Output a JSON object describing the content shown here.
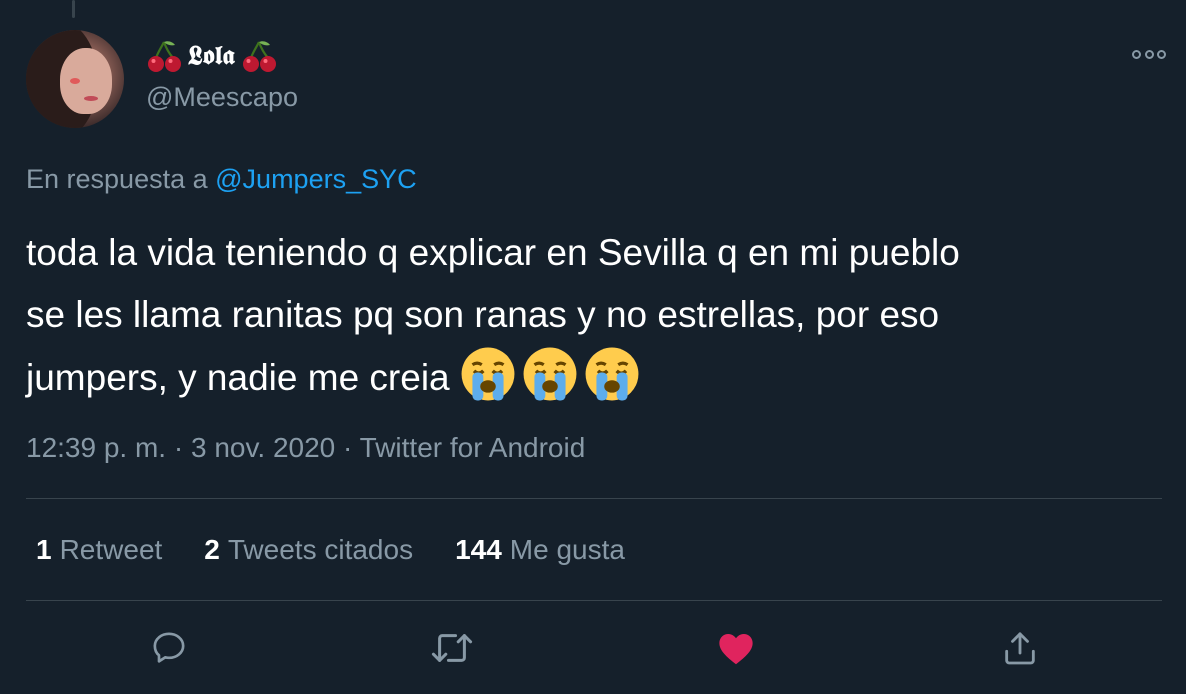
{
  "author": {
    "display_name": "𝕷𝖔𝖑𝖆",
    "handle": "@Meescapo",
    "name_decoration_icon": "cherry-icon"
  },
  "reply": {
    "prefix": "En respuesta a",
    "mention": "@Jumpers_SYC"
  },
  "tweet": {
    "line1": "toda la vida teniendo q explicar en Sevilla q en mi pueblo",
    "line2": "se les llama ranitas pq son ranas y no estrellas, por eso",
    "line3": "jumpers, y nadie me creia",
    "emojis": [
      "loudly-crying-face",
      "loudly-crying-face",
      "loudly-crying-face"
    ]
  },
  "meta": {
    "time": "12:39 p. m.",
    "sep1": "·",
    "date": "3 nov. 2020",
    "sep2": "·",
    "source": "Twitter for Android"
  },
  "stats": {
    "retweets_count": "1",
    "retweets_label": "Retweet",
    "quotes_count": "2",
    "quotes_label": "Tweets citados",
    "likes_count": "144",
    "likes_label": "Me gusta"
  },
  "actions": {
    "reply_icon": "reply-icon",
    "retweet_icon": "retweet-icon",
    "like_icon": "heart-icon",
    "share_icon": "share-icon"
  },
  "colors": {
    "background": "#15202b",
    "secondary_text": "#8899a6",
    "link": "#1da1f2",
    "like_active": "#e0245e",
    "divider": "#38444d"
  }
}
